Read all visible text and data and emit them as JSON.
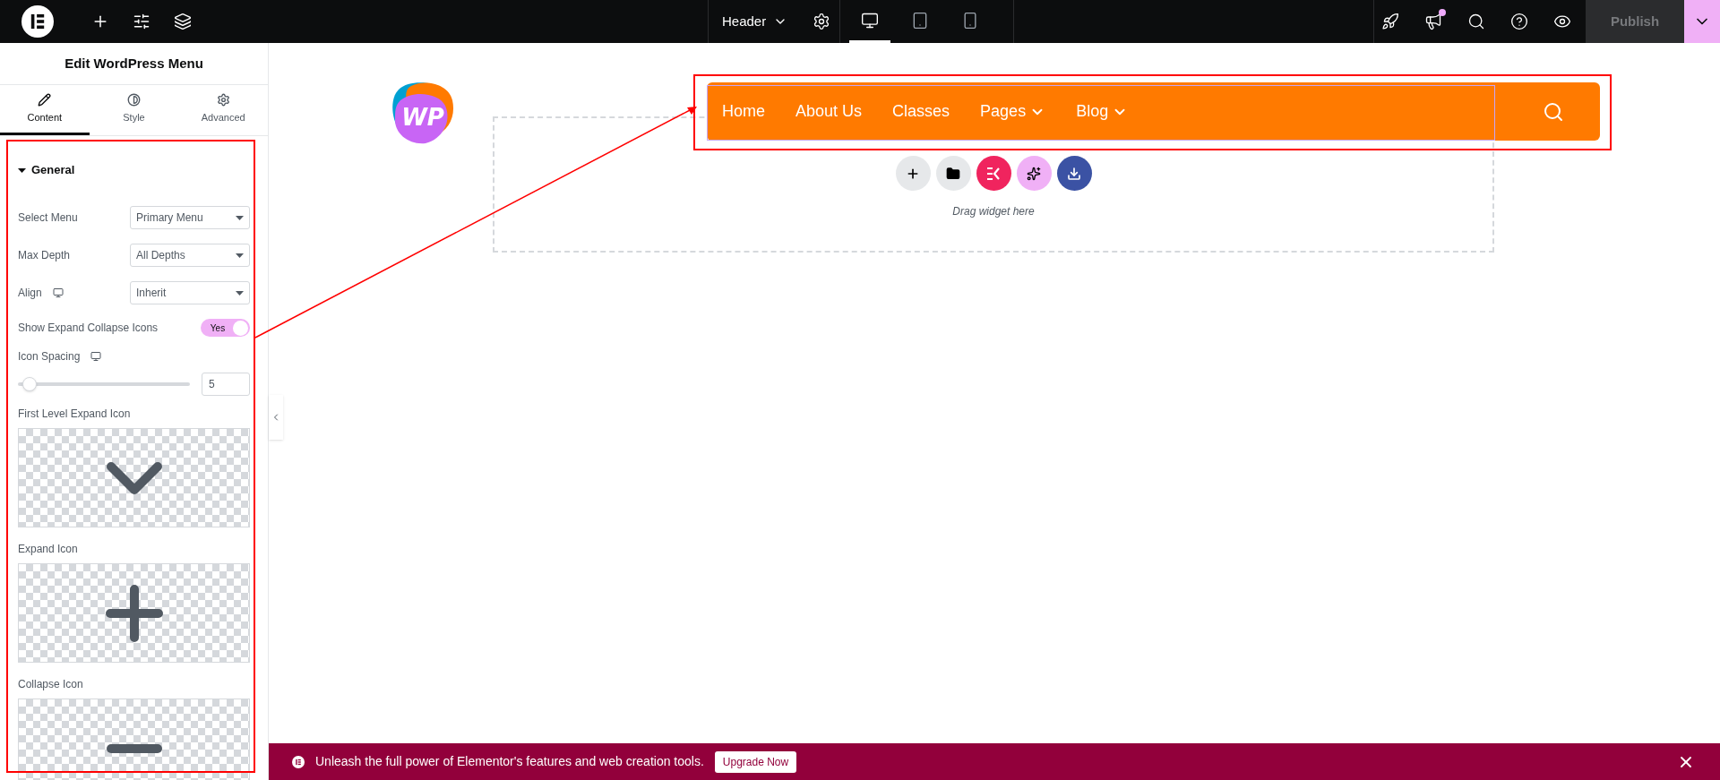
{
  "topbar": {
    "document": "Header",
    "devices": [
      {
        "kind": "desktop",
        "selected": true
      },
      {
        "kind": "tablet",
        "selected": false
      },
      {
        "kind": "mobile",
        "selected": false
      }
    ],
    "notification": true,
    "publish": {
      "label": "Publish",
      "disabled": true
    }
  },
  "panel": {
    "title": "Edit WordPress Menu",
    "tabs": [
      {
        "label": "Content",
        "selected": true
      },
      {
        "label": "Style",
        "selected": false
      },
      {
        "label": "Advanced",
        "selected": false
      }
    ],
    "section": {
      "title": "General",
      "expanded": true
    },
    "controls": [
      {
        "kind": "select",
        "label": "Select Menu",
        "value": "Primary Menu",
        "responsive": false
      },
      {
        "kind": "select",
        "label": "Max Depth",
        "value": "All Depths",
        "responsive": false
      },
      {
        "kind": "select",
        "label": "Align",
        "value": "Inherit",
        "responsive": true
      },
      {
        "kind": "switch",
        "label": "Show Expand Collapse Icons",
        "on": true,
        "state_label": "Yes"
      },
      {
        "kind": "slider",
        "label": "Icon Spacing",
        "responsive": true,
        "level": 0.03,
        "value": "5"
      },
      {
        "kind": "icon",
        "label": "First Level Expand Icon"
      },
      {
        "kind": "icon",
        "label": "Expand Icon"
      },
      {
        "kind": "icon",
        "label": "Collapse Icon"
      }
    ]
  },
  "canvas": {
    "logo_text": "WP",
    "menu": [
      {
        "label": "Home",
        "has_submenu": false
      },
      {
        "label": "About Us",
        "has_submenu": false
      },
      {
        "label": "Classes",
        "has_submenu": false
      },
      {
        "label": "Pages",
        "has_submenu": true
      },
      {
        "label": "Blog",
        "has_submenu": true
      }
    ],
    "drop_zone": {
      "hint": "Drag widget here"
    }
  },
  "banner": {
    "text": "Unleash the full power of Elementor's features and web creation tools.",
    "button": "Upgrade Now"
  }
}
